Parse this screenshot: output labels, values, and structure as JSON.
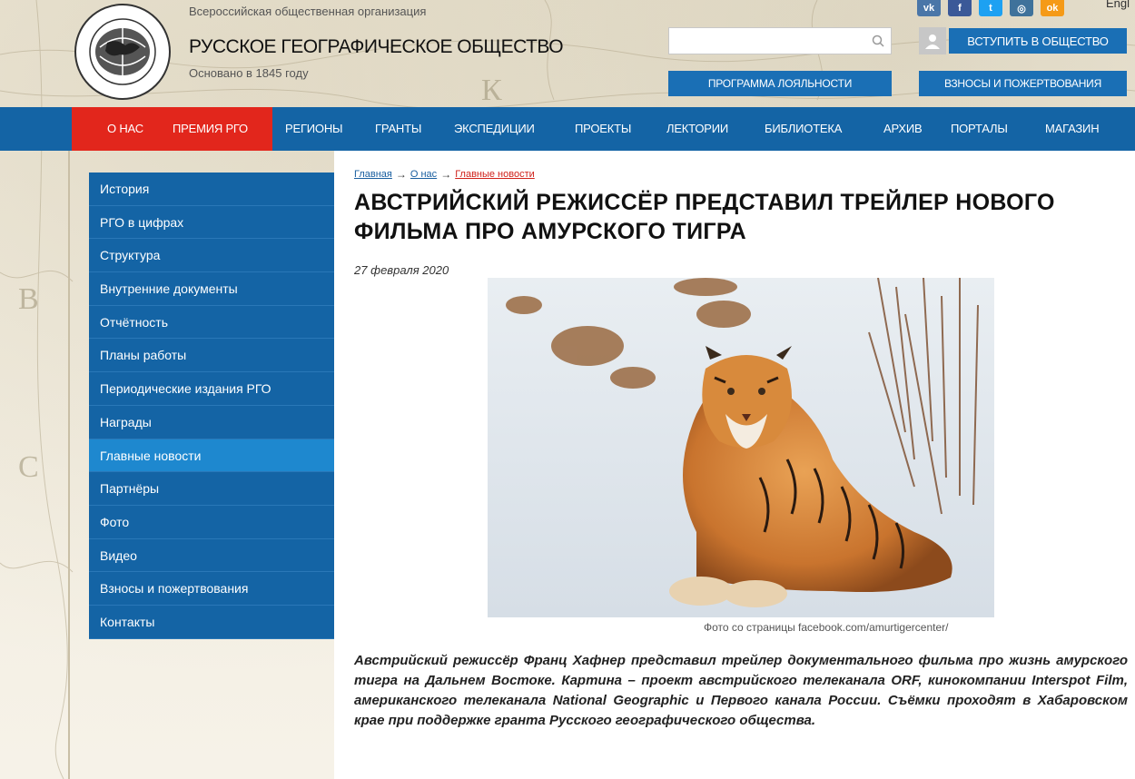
{
  "header": {
    "org_subtitle": "Всероссийская общественная организация",
    "org_title": "РУССКОЕ ГЕОГРАФИЧЕСКОЕ ОБЩЕСТВО",
    "org_founded": "Основано в 1845 году",
    "lang": "Engl",
    "search": {
      "placeholder": "",
      "value": "",
      "icon": "search-icon"
    },
    "join_button": "ВСТУПИТЬ В ОБЩЕСТВО",
    "loyalty_button": "ПРОГРАММА ЛОЯЛЬНОСТИ",
    "donate_button": "ВЗНОСЫ И ПОЖЕРТВОВАНИЯ",
    "socials": [
      {
        "name": "vk-icon",
        "label": "vk",
        "color": "#4a76a8"
      },
      {
        "name": "facebook-icon",
        "label": "f",
        "color": "#3b5998"
      },
      {
        "name": "twitter-icon",
        "label": "t",
        "color": "#1da1f2"
      },
      {
        "name": "instagram-icon",
        "label": "◎",
        "color": "#3f729b"
      },
      {
        "name": "odnoklassniki-icon",
        "label": "ok",
        "color": "#f59a17"
      }
    ]
  },
  "nav": {
    "items": [
      "О НАС",
      "ПРЕМИЯ РГО",
      "РЕГИОНЫ",
      "ГРАНТЫ",
      "ЭКСПЕДИЦИИ",
      "ПРОЕКТЫ",
      "ЛЕКТОРИИ",
      "БИБЛИОТЕКА",
      "АРХИВ",
      "ПОРТАЛЫ",
      "МАГАЗИН"
    ]
  },
  "sidebar": {
    "items": [
      {
        "label": "История",
        "active": false
      },
      {
        "label": "РГО в цифрах",
        "active": false
      },
      {
        "label": "Структура",
        "active": false
      },
      {
        "label": "Внутренние документы",
        "active": false
      },
      {
        "label": "Отчётность",
        "active": false
      },
      {
        "label": "Планы работы",
        "active": false
      },
      {
        "label": "Периодические издания РГО",
        "active": false
      },
      {
        "label": "Награды",
        "active": false
      },
      {
        "label": "Главные новости",
        "active": true
      },
      {
        "label": "Партнёры",
        "active": false
      },
      {
        "label": "Фото",
        "active": false
      },
      {
        "label": "Видео",
        "active": false
      },
      {
        "label": "Взносы и пожертвования",
        "active": false
      },
      {
        "label": "Контакты",
        "active": false
      }
    ]
  },
  "breadcrumb": {
    "home": "Главная",
    "about": "О нас",
    "current": "Главные новости",
    "separator": "→"
  },
  "article": {
    "title": "АВСТРИЙСКИЙ РЕЖИССЁР ПРЕДСТАВИЛ ТРЕЙЛЕР НОВОГО ФИЛЬМА ПРО АМУРСКОГО ТИГРА",
    "date": "27 февраля 2020",
    "photo_caption": "Фото со страницы facebook.com/amurtigercenter/",
    "lead": "Австрийский режиссёр Франц Хафнер представил трейлер документального фильма про жизнь амурского тигра на Дальнем Востоке. Картина – проект австрийского телеканала ORF, кинокомпании Interspot Film, американского телеканала National Geographic и Первого канала России. Съёмки проходят в Хабаровском крае при поддержке гранта Русского географического общества."
  },
  "colors": {
    "nav_blue": "#1464a5",
    "nav_red": "#e2261c",
    "sidebar_active": "#1e88cf"
  }
}
